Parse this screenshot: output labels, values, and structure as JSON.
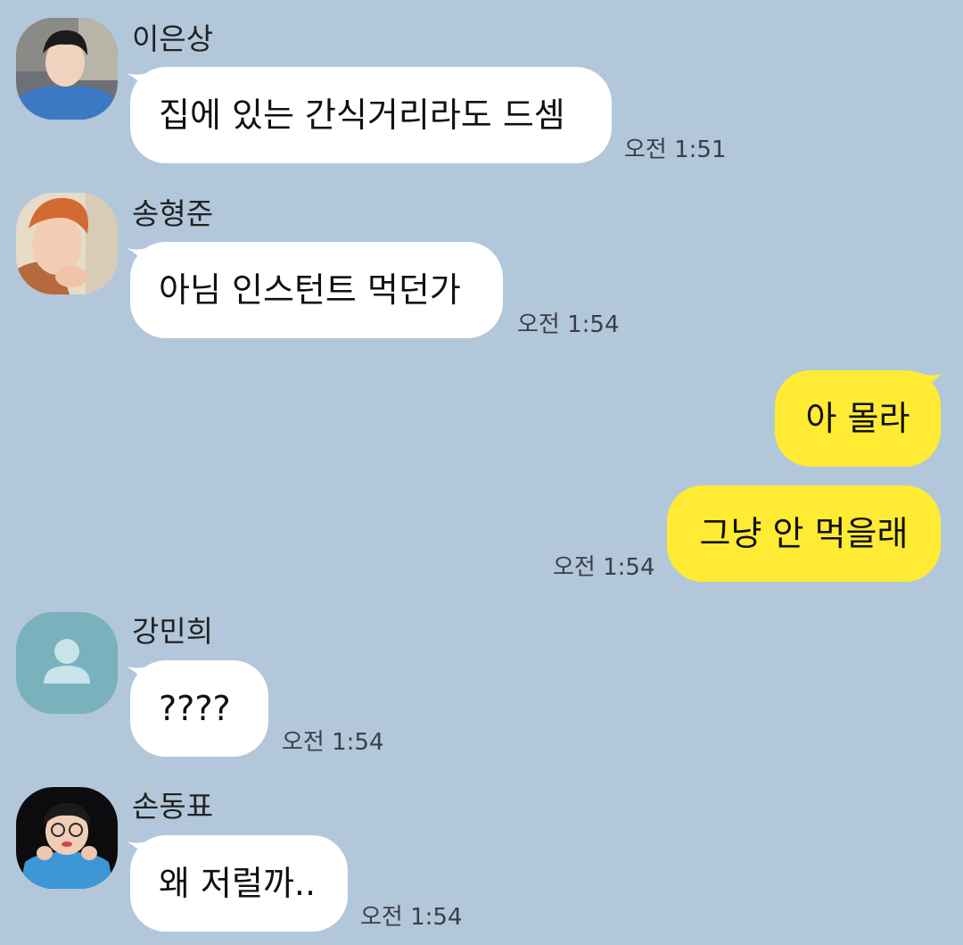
{
  "chat": {
    "messages": [
      {
        "sender": "이은상",
        "text": "집에 있는 간식거리라도 드셈",
        "time": "오전 1:51"
      },
      {
        "sender": "송형준",
        "text": "아님 인스턴트 먹던가",
        "time": "오전 1:54"
      },
      {
        "text": "아 몰라"
      },
      {
        "text": "그냥 안 먹을래",
        "time": "오전 1:54"
      },
      {
        "sender": "강민희",
        "text": "????",
        "time": "오전 1:54"
      },
      {
        "sender": "손동표",
        "text": "왜 저럴까..",
        "time": "오전 1:54"
      }
    ]
  },
  "icons": {
    "default_avatar": "person-icon"
  },
  "colors": {
    "background": "#b2c7da",
    "incoming_bubble": "#ffffff",
    "outgoing_bubble": "#ffeb33",
    "default_avatar": "#79b1bd"
  }
}
